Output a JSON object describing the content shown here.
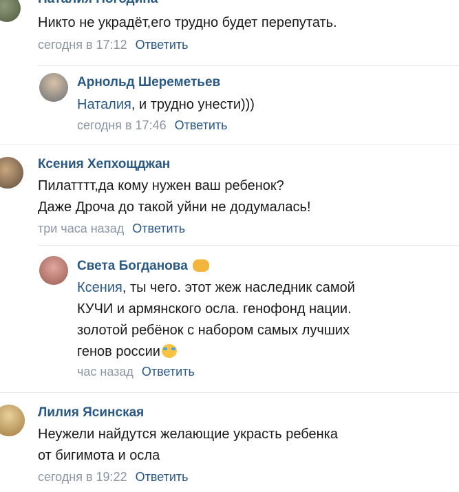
{
  "comments": [
    {
      "author": "Наталия Погодина",
      "text": "Никто не украдёт,его трудно будет перепутать.",
      "time": "сегодня в 17:12",
      "reply_label": "Ответить"
    },
    {
      "author": "Арнольд Шереметьев",
      "mention": "Наталия",
      "text": ", и трудно унести)))",
      "time": "сегодня в 17:46",
      "reply_label": "Ответить"
    },
    {
      "author": "Ксения Хепхощджан",
      "text_line1": "Пилатттт,да кому нужен ваш ребенок?",
      "text_line2": "Даже Дроча до такой уйни не додумалась!",
      "time": "три часа назад",
      "reply_label": "Ответить"
    },
    {
      "author": "Света Богданова",
      "author_emoji": "fist-emoji",
      "mention": "Ксения",
      "text_line1": ", ты чего. этот жеж наследник самой",
      "text_line2": "КУЧИ и армянского осла. генофонд нации.",
      "text_line3": "золотой ребёнок с набором самых лучших",
      "text_line4": "генов россии",
      "text_emoji": "laughing-tears-emoji",
      "time": "час назад",
      "reply_label": "Ответить"
    },
    {
      "author": "Лилия Ясинская",
      "text_line1": "Неужели найдутся желающие украсть ребенка",
      "text_line2": "от бигимота и осла",
      "time": "сегодня в 19:22",
      "reply_label": "Ответить"
    }
  ],
  "colors": {
    "link": "#2a5885",
    "meta": "#8c96a3",
    "separator": "#e7e8ec"
  }
}
